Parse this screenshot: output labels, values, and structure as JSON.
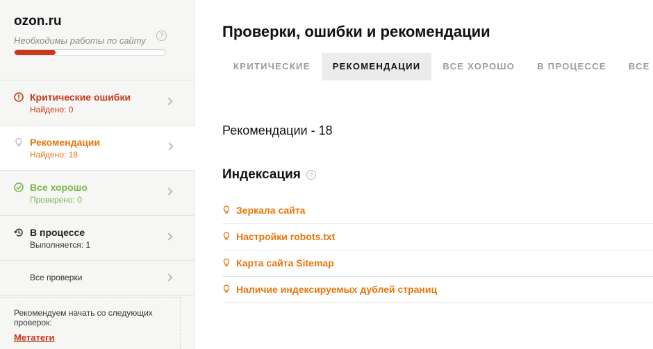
{
  "site": {
    "name": "ozon.ru",
    "subtitle": "Необходимы работы по сайту",
    "help": "?",
    "progress": 0.27
  },
  "nav": {
    "critical": {
      "title": "Критические ошибки",
      "sub": "Найдено: 0",
      "icon": "alert-circle-icon",
      "color": "#c9371d"
    },
    "recommend": {
      "title": "Рекомендации",
      "sub": "Найдено: 18",
      "icon": "lightbulb-icon",
      "color": "#e5770e"
    },
    "good": {
      "title": "Все хорошо",
      "sub": "Проверено: 0",
      "icon": "check-circle-icon",
      "color": "#77b84a"
    },
    "progress": {
      "title": "В процессе",
      "sub": "Выполняется: 1",
      "icon": "history-icon"
    },
    "all": {
      "title": "Все проверки"
    }
  },
  "recommend_box": {
    "text": "Рекомендуем начать со следующих проверок:",
    "link": "Метатеги"
  },
  "main": {
    "title": "Проверки, ошибки и рекомендации",
    "tabs": [
      "КРИТИЧЕСКИЕ",
      "РЕКОМЕНДАЦИИ",
      "ВСЕ ХОРОШО",
      "В ПРОЦЕССЕ",
      "ВСЕ"
    ],
    "active_tab": 1,
    "count_label": "Рекомендации - 18",
    "section_title": "Индексация",
    "section_help": "?",
    "items": [
      "Зеркала сайта",
      "Настройки robots.txt",
      "Карта сайта Sitemap",
      "Наличие индексируемых дублей страниц"
    ]
  },
  "colors": {
    "accent_red": "#c9371d",
    "accent_orange": "#e5770e",
    "accent_green": "#77b84a"
  }
}
